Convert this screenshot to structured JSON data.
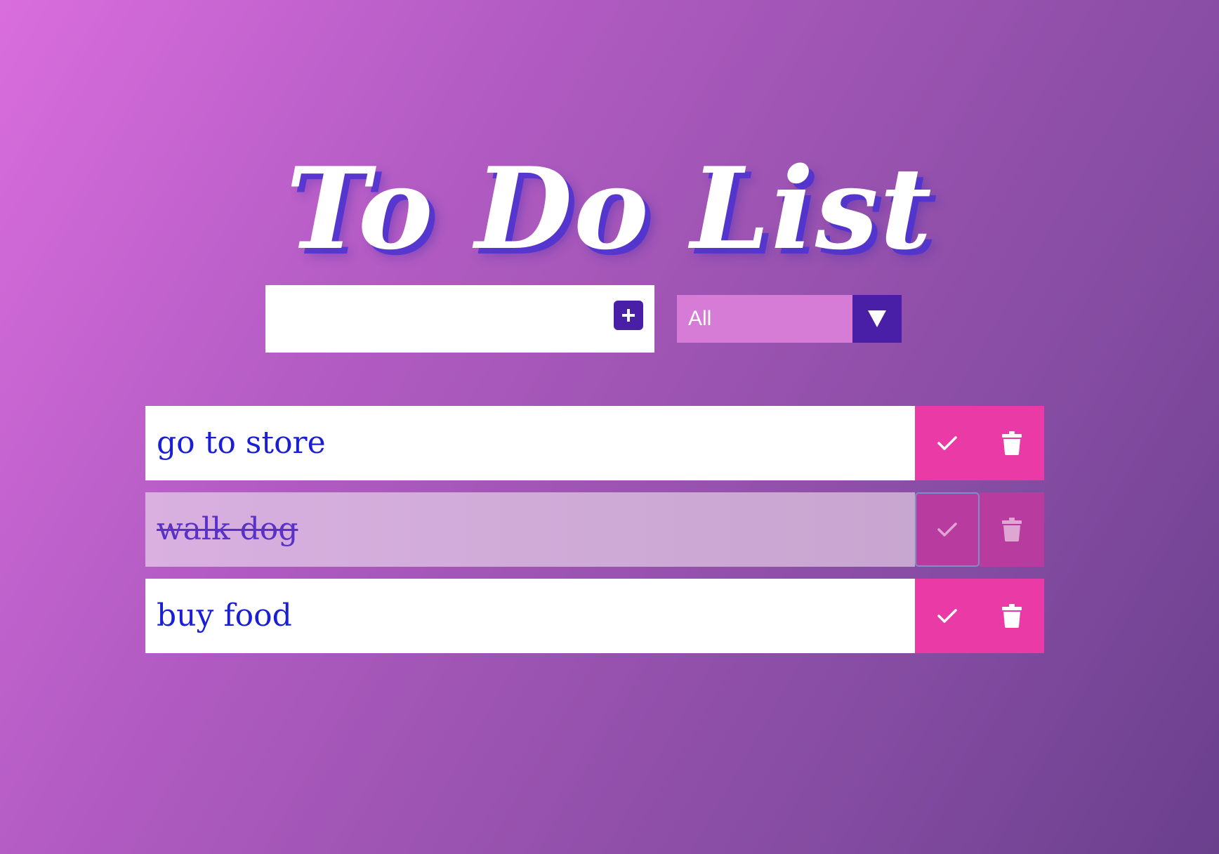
{
  "app": {
    "title": "To Do List"
  },
  "controls": {
    "input_value": "",
    "add_icon": "plus-icon",
    "filter_value": "All",
    "filter_arrow_icon": "triangle-down-icon"
  },
  "todos": [
    {
      "text": "go to store",
      "completed": false
    },
    {
      "text": "walk dog",
      "completed": true
    },
    {
      "text": "buy food",
      "completed": false
    }
  ],
  "icons": {
    "complete": "check-icon",
    "delete": "trash-icon"
  },
  "colors": {
    "accent_dark": "#4a1fa8",
    "select_bg": "#d67cd7",
    "button_pink": "#ea3aa6",
    "todo_text": "#1a1fd6"
  }
}
